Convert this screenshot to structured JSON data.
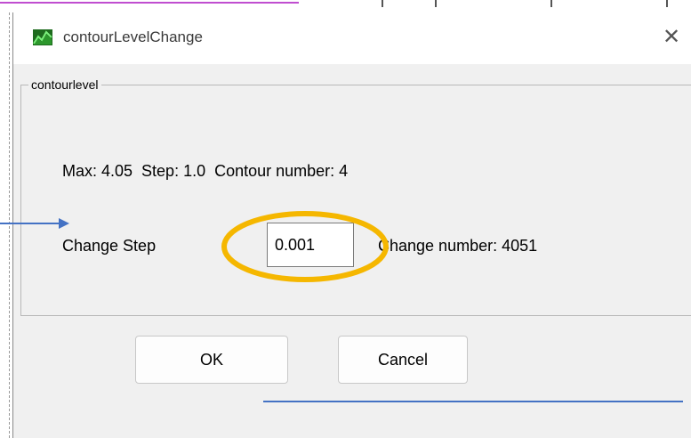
{
  "window": {
    "title": "contourLevelChange",
    "close_glyph": "✕",
    "icon": "app-chart-icon"
  },
  "group": {
    "label": "contourlevel",
    "info_line": "Max: 4.05  Step: 1.0  Contour number: 4",
    "change_step_label": "Change Step",
    "change_step_value": "0.001",
    "change_number_text": "Change number: 4051"
  },
  "buttons": {
    "ok_label": "OK",
    "cancel_label": "Cancel"
  },
  "annotation": {
    "highlight_color": "#f5b700",
    "arrow_color": "#4472c4"
  }
}
